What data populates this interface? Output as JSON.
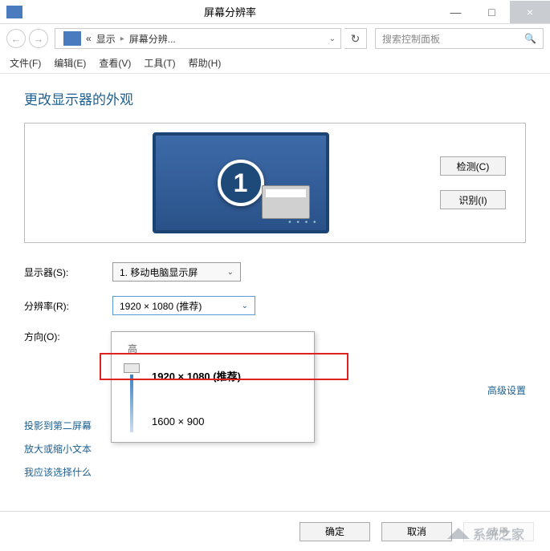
{
  "window": {
    "title": "屏幕分辨率",
    "min": "—",
    "max": "□",
    "close": "×"
  },
  "nav": {
    "back": "←",
    "forward": "→",
    "chevrons": "«",
    "seg1": "显示",
    "seg2": "屏幕分辨...",
    "dropdown_caret": "⌄",
    "refresh": "↻"
  },
  "search": {
    "placeholder": "搜索控制面板",
    "icon": "🔍"
  },
  "menu": {
    "file": "文件(F)",
    "edit": "编辑(E)",
    "view": "查看(V)",
    "tools": "工具(T)",
    "help": "帮助(H)"
  },
  "page": {
    "title": "更改显示器的外观",
    "monitor_number": "1",
    "monitor_dots": "• • • •",
    "detect_btn": "检测(C)",
    "identify_btn": "识别(I)"
  },
  "form": {
    "display_label": "显示器(S):",
    "display_value": "1. 移动电脑显示屏",
    "resolution_label": "分辨率(R):",
    "resolution_value": "1920 × 1080 (推荐)",
    "orientation_label": "方向(O):"
  },
  "dropdown": {
    "header": "高",
    "opt1": "1920 × 1080 (推荐)",
    "opt2": "1600 × 900"
  },
  "links": {
    "advanced": "高级设置",
    "project": "投影到第二屏幕",
    "scale": "放大或缩小文本",
    "choose": "我应该选择什么"
  },
  "footer": {
    "ok": "确定",
    "cancel": "取消",
    "apply": "应用"
  },
  "watermark": "系统之家"
}
